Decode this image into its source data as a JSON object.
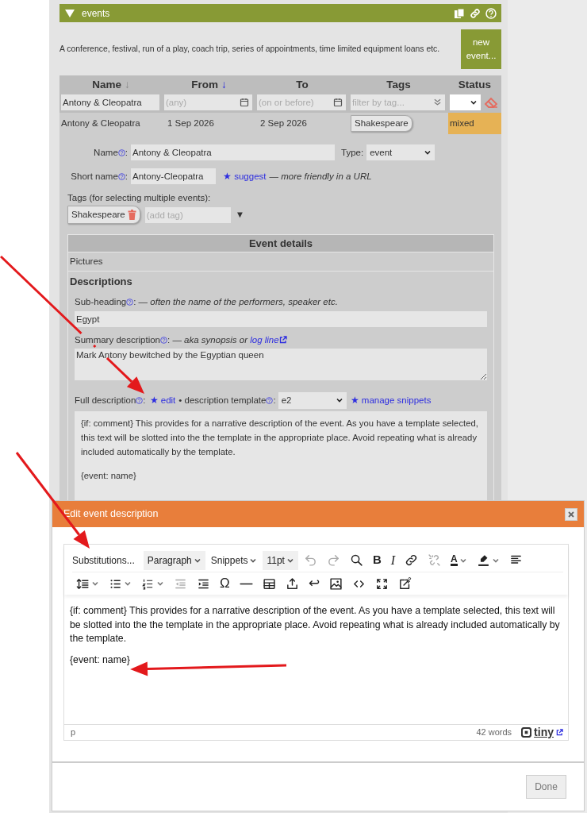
{
  "section": {
    "title": "events",
    "expanded": true,
    "description": "A conference, festival, run of a play, coach trip, series of appointments, time limited equipment loans etc.",
    "new_button": "new event..."
  },
  "table": {
    "columns": [
      {
        "label": "Name",
        "sort_arrow": "↓",
        "selected": false
      },
      {
        "label": "From",
        "sort_arrow": "↓",
        "selected": true
      },
      {
        "label": "To"
      },
      {
        "label": "Tags"
      },
      {
        "label": "Status"
      }
    ],
    "filters": [
      {
        "kind": "text",
        "value": "Antony & Cleopatra"
      },
      {
        "kind": "date",
        "placeholder": "(any)"
      },
      {
        "kind": "date",
        "placeholder": "(on or before)"
      },
      {
        "kind": "tags",
        "placeholder": "filter by tag..."
      },
      {
        "kind": "select"
      }
    ],
    "rows": [
      {
        "cells": [
          "Antony & Cleopatra",
          "1 Sep 2026",
          "2 Sep 2026"
        ],
        "tag": "Shakespeare",
        "status": "mixed",
        "color": "#e6b255"
      }
    ]
  },
  "form": {
    "name": {
      "label": "Name",
      "help": true,
      "suffix": ":",
      "value": "Antony & Cleopatra"
    },
    "type": {
      "label": "Type:",
      "value": "event"
    },
    "short_name": {
      "label": "Short name",
      "help": true,
      "suffix": ":",
      "value": "Antony-Cleopatra",
      "link": "★ suggest",
      "note": "— *more friendly in a URL*"
    },
    "tags_label": "Tags (for selecting multiple events):",
    "tags": [
      {
        "label": "Shakespeare"
      }
    ],
    "add_tag": {
      "placeholder": "(add tag)",
      "menu_glyph": "▼"
    }
  },
  "details": {
    "title": "Event details",
    "pictures": "Pictures",
    "descriptions": {
      "title": "Descriptions",
      "subheading": {
        "label": "Sub-heading",
        "help": true,
        "note": ": — *often the name of the performers, speaker etc.*",
        "value": "Egypt"
      },
      "summary": {
        "label": "Summary description",
        "help": true,
        "note": ": — *aka synopsis or*",
        "link": "log line",
        "value": "Mark Antony bewitched by the Egyptian queen"
      },
      "full": {
        "label": "Full description",
        "help": true,
        "suffix": ":",
        "edit_link": "★ edit",
        "template_label": "• description template",
        "template_help": true,
        "template_suffix": ":",
        "template_value": "e2",
        "snippets_link": "★ manage snippets",
        "paragraphs": [
          "{if: comment} This provides for a narrative description of the event. As you have a template selected, this text will be slotted into the the template in the appropriate place. Avoid repeating what is already included automatically by the template.",
          "{event: name}"
        ]
      }
    }
  },
  "dialog": {
    "title": "Edit event description",
    "toolbar_rows": [
      [
        {
          "kind": "menu",
          "label": "Substitutions..."
        },
        {
          "kind": "dropdown",
          "label": "Paragraph",
          "shaded": true
        },
        {
          "kind": "dropdown",
          "label": "Snippets",
          "shaded": false
        },
        {
          "kind": "dropdown",
          "label": "11pt",
          "shaded": true
        },
        {
          "kind": "icon",
          "disabled": true
        },
        {
          "kind": "icon",
          "disabled": true
        },
        {
          "kind": "icon",
          "disabled": false
        },
        {
          "kind": "glyph",
          "text": "B"
        },
        {
          "kind": "glyph",
          "text": "I"
        },
        {
          "kind": "icon",
          "disabled": false
        },
        {
          "kind": "icon",
          "disabled": true
        },
        {
          "kind": "glyph",
          "text": "A",
          "caret": true
        },
        {
          "kind": "icon",
          "disabled": false,
          "caret": true
        },
        {
          "kind": "icon",
          "disabled": false
        }
      ],
      [
        {
          "kind": "icon",
          "disabled": false,
          "caret": true
        },
        {
          "kind": "icon",
          "disabled": false,
          "caret": true
        },
        {
          "kind": "icon",
          "disabled": false,
          "caret": true
        },
        {
          "kind": "icon",
          "disabled": true
        },
        {
          "kind": "icon",
          "disabled": false
        },
        {
          "kind": "glyph",
          "text": "Ω"
        },
        {
          "kind": "icon",
          "disabled": false
        },
        {
          "kind": "icon",
          "disabled": false
        },
        {
          "kind": "icon",
          "disabled": false
        },
        {
          "kind": "glyph",
          "text": "↩"
        },
        {
          "kind": "icon",
          "disabled": false
        },
        {
          "kind": "icon",
          "disabled": false
        },
        {
          "kind": "icon",
          "disabled": false
        },
        {
          "kind": "icon",
          "disabled": false
        }
      ]
    ],
    "content": [
      "{if: comment} This provides for a narrative description of the event. As you have a template selected, this text will be slotted into the the template in the appropriate place. Avoid repeating what is already included automatically by the template.",
      "{event: name}"
    ],
    "path": "p",
    "word_count": "42 words",
    "brand": "tiny",
    "done": "Done"
  }
}
